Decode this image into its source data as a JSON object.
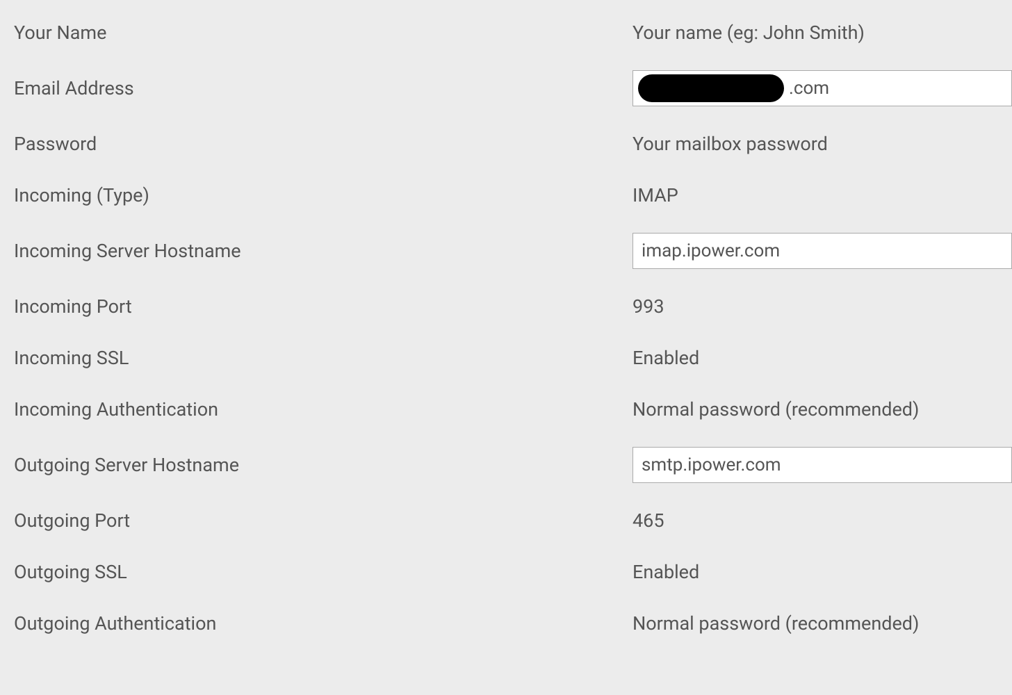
{
  "settings": {
    "your_name": {
      "label": "Your Name",
      "value": "Your name (eg: John Smith)"
    },
    "email_address": {
      "label": "Email Address",
      "value": ".com"
    },
    "password": {
      "label": "Password",
      "value": "Your mailbox password"
    },
    "incoming_type": {
      "label": "Incoming (Type)",
      "value": "IMAP"
    },
    "incoming_server_hostname": {
      "label": "Incoming Server Hostname",
      "value": "imap.ipower.com"
    },
    "incoming_port": {
      "label": "Incoming Port",
      "value": "993"
    },
    "incoming_ssl": {
      "label": "Incoming SSL",
      "value": "Enabled"
    },
    "incoming_authentication": {
      "label": "Incoming Authentication",
      "value": "Normal password (recommended)"
    },
    "outgoing_server_hostname": {
      "label": "Outgoing Server Hostname",
      "value": "smtp.ipower.com"
    },
    "outgoing_port": {
      "label": "Outgoing Port",
      "value": "465"
    },
    "outgoing_ssl": {
      "label": "Outgoing SSL",
      "value": "Enabled"
    },
    "outgoing_authentication": {
      "label": "Outgoing Authentication",
      "value": "Normal password (recommended)"
    }
  }
}
